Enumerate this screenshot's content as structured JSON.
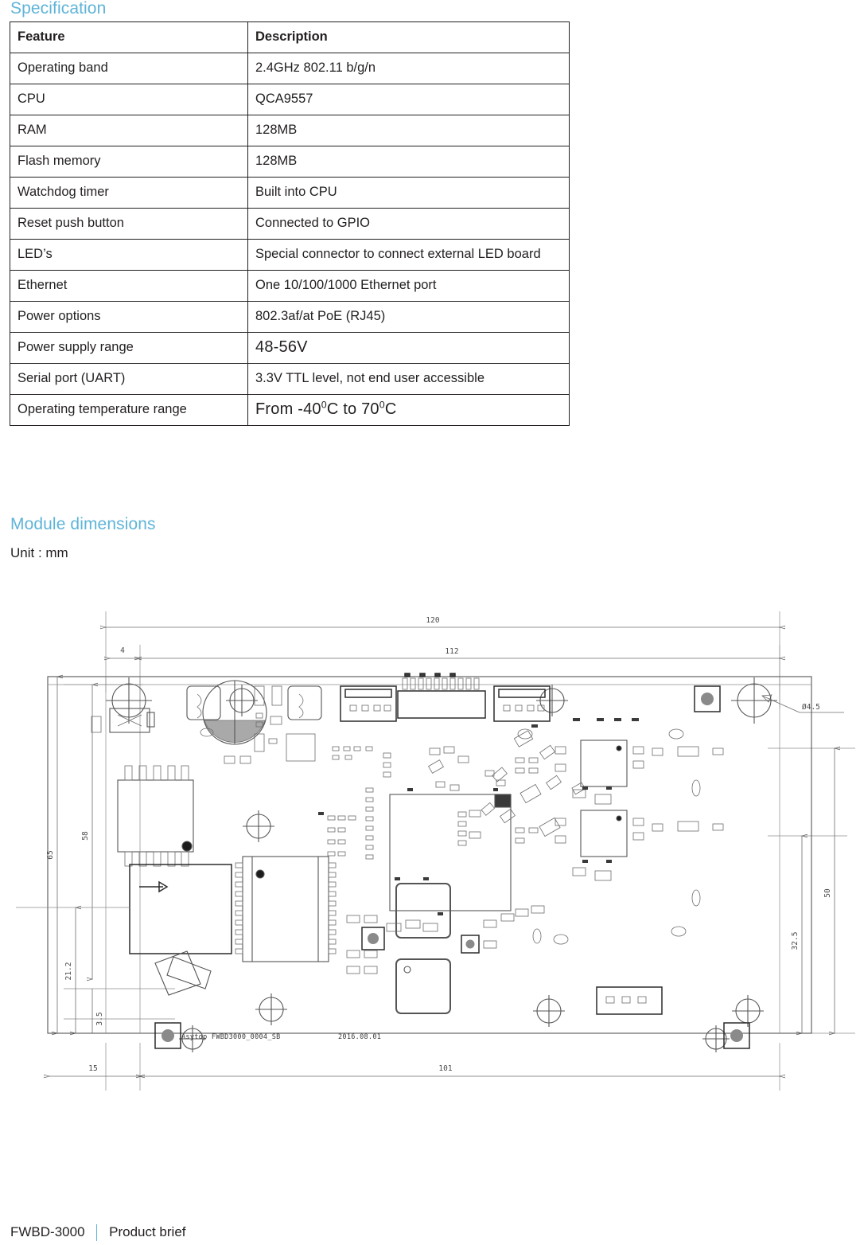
{
  "document": {
    "sections": {
      "specification_heading": "Specification",
      "module_dimensions_heading": "Module dimensions",
      "unit_line": "Unit : mm"
    },
    "accent_color": "#5fb4d8",
    "text_color": "#231f20"
  },
  "spec_table": {
    "columns": [
      "Feature",
      "Description"
    ],
    "rows": [
      {
        "feature": "Operating band",
        "description": "2.4GHz 802.11 b/g/n"
      },
      {
        "feature": "CPU",
        "description": "QCA9557"
      },
      {
        "feature": "RAM",
        "description": "128MB"
      },
      {
        "feature": "Flash memory",
        "description": "128MB"
      },
      {
        "feature": "Watchdog timer",
        "description": "Built into CPU"
      },
      {
        "feature": "Reset push button",
        "description": "Connected to GPIO"
      },
      {
        "feature": "LED’s",
        "description": "Special connector to connect external LED board"
      },
      {
        "feature": "Ethernet",
        "description": "One 10/100/1000 Ethernet port"
      },
      {
        "feature": "Power options",
        "description": "802.3af/at PoE (RJ45)"
      },
      {
        "feature": "Power supply range",
        "description": "48-56V"
      },
      {
        "feature": "Serial port (UART)",
        "description": "3.3V TTL level, not end user accessible"
      },
      {
        "feature": "Operating temperature range",
        "description": "From -40⁰C to 70⁰C"
      }
    ]
  },
  "drawing": {
    "title_text": "Asytop FWBD3000_0004_SB",
    "date_text": "2016.08.01",
    "dimensions": {
      "top_overall": "120",
      "top_inner": "112",
      "top_offset": "4",
      "left_overall": "65",
      "left_inner": "58",
      "left_mid": "21.2",
      "left_small": "3.5",
      "right_overall": "50",
      "right_mid": "32.5",
      "bottom_left": "15",
      "bottom_main": "101",
      "hole_callout": "Ø4.5"
    }
  },
  "footer": {
    "model": "FWBD-3000",
    "doc_type": "Product brief"
  }
}
